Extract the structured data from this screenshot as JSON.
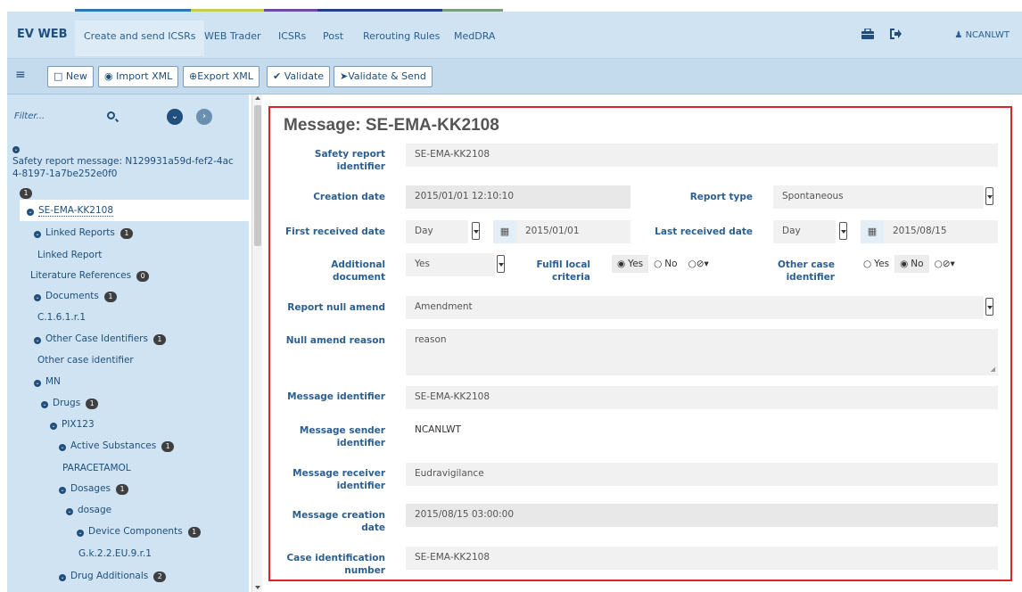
{
  "nav": {
    "brand": "EV WEB",
    "items": [
      "Create and send ICSRs",
      "WEB Trader",
      "ICSRs",
      "Post",
      "Rerouting Rules",
      "MedDRA"
    ],
    "user": "NCANLWT",
    "accent_colors": [
      "#2e75b6",
      "#c9c95a",
      "#6b4aa0",
      "#1f3f8a",
      "#7aa07a"
    ]
  },
  "toolbar": {
    "new": "New",
    "import_xml": "Import XML",
    "export_xml": "Export XML",
    "validate": "Validate",
    "validate_send": "Validate & Send"
  },
  "sidebar": {
    "filter_placeholder": "Filter...",
    "root_line1": "Safety report message: N129931a59d-fef2-4ac",
    "root_line2": "4-8197-1a7be252e0f0",
    "root_badge": "1",
    "tree": [
      {
        "label": "SE-EMA-KK2108",
        "chev": true,
        "badge": ""
      },
      {
        "label": "Linked Reports",
        "chev": true,
        "badge": "1"
      },
      {
        "label": "Linked Report",
        "chev": false,
        "badge": ""
      },
      {
        "label": "Literature References",
        "chev": false,
        "badge": "0"
      },
      {
        "label": "Documents",
        "chev": true,
        "badge": "1"
      },
      {
        "label": "C.1.6.1.r.1",
        "chev": false,
        "badge": ""
      },
      {
        "label": "Other Case Identifiers",
        "chev": true,
        "badge": "1"
      },
      {
        "label": "Other case identifier",
        "chev": false,
        "badge": ""
      },
      {
        "label": "MN",
        "chev": true,
        "badge": ""
      },
      {
        "label": "Drugs",
        "chev": true,
        "badge": "1"
      },
      {
        "label": "PIX123",
        "chev": true,
        "badge": ""
      },
      {
        "label": "Active Substances",
        "chev": true,
        "badge": "1"
      },
      {
        "label": "PARACETAMOL",
        "chev": false,
        "badge": ""
      },
      {
        "label": "Dosages",
        "chev": true,
        "badge": "1"
      },
      {
        "label": "dosage",
        "chev": true,
        "badge": ""
      },
      {
        "label": "Device Components",
        "chev": true,
        "badge": "1"
      },
      {
        "label": "G.k.2.2.EU.9.r.1",
        "chev": false,
        "badge": ""
      },
      {
        "label": "Drug Additionals",
        "chev": true,
        "badge": "2"
      }
    ]
  },
  "form": {
    "title": "Message: SE-EMA-KK2108",
    "safety_report_identifier_label": "Safety report identifier",
    "safety_report_identifier": "SE-EMA-KK2108",
    "creation_date_label": "Creation date",
    "creation_date": "2015/01/01 12:10:10",
    "report_type_label": "Report type",
    "report_type": "Spontaneous",
    "first_received_label": "First received date",
    "first_received_unit": "Day",
    "first_received_date": "2015/01/01",
    "last_received_label": "Last received date",
    "last_received_unit": "Day",
    "last_received_date": "2015/08/15",
    "additional_document_label": "Additional document",
    "additional_document": "Yes",
    "fulfil_local_label": "Fulfil local criteria",
    "fulfil_yes": "Yes",
    "fulfil_no": "No",
    "other_case_label": "Other case identifier",
    "other_yes": "Yes",
    "other_no": "No",
    "report_null_amend_label": "Report null amend",
    "report_null_amend": "Amendment",
    "null_amend_reason_label": "Null amend reason",
    "null_amend_reason": "reason",
    "message_identifier_label": "Message identifier",
    "message_identifier": "SE-EMA-KK2108",
    "message_sender_label": "Message sender identifier",
    "message_sender": "NCANLWT",
    "message_receiver_label": "Message receiver identifier",
    "message_receiver": "Eudravigilance",
    "message_creation_label": "Message creation date",
    "message_creation": "2015/08/15 03:00:00",
    "case_identification_label": "Case identification number",
    "case_identification": "SE-EMA-KK2108"
  }
}
